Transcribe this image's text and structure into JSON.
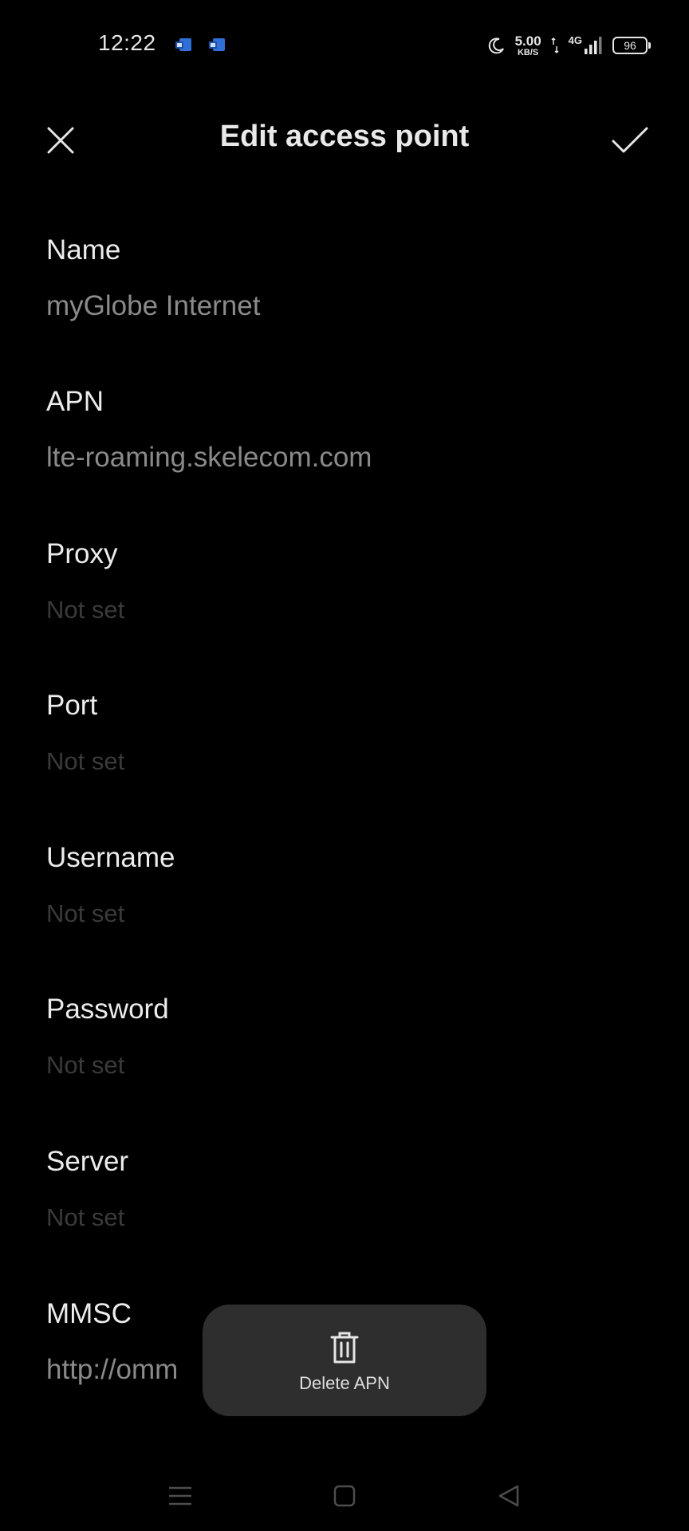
{
  "status_bar": {
    "time": "12:22",
    "speed_value": "5.00",
    "speed_unit": "KB/S",
    "network_type": "4G",
    "battery": "96",
    "icons": [
      "messenger-notification-icon",
      "messenger-notification-icon",
      "do-not-disturb-moon-icon",
      "data-transfer-arrows-icon",
      "cell-signal-icon",
      "battery-icon"
    ]
  },
  "header": {
    "title": "Edit access point",
    "close_icon": "close-icon",
    "confirm_icon": "check-icon"
  },
  "fields": [
    {
      "label": "Name",
      "value": "myGlobe Internet",
      "is_set": true
    },
    {
      "label": "APN",
      "value": "lte-roaming.skelecom.com",
      "is_set": true
    },
    {
      "label": "Proxy",
      "value": "Not set",
      "is_set": false
    },
    {
      "label": "Port",
      "value": "Not set",
      "is_set": false
    },
    {
      "label": "Username",
      "value": "Not set",
      "is_set": false
    },
    {
      "label": "Password",
      "value": "Not set",
      "is_set": false
    },
    {
      "label": "Server",
      "value": "Not set",
      "is_set": false
    },
    {
      "label": "MMSC",
      "value": "http://omm",
      "is_set": true
    }
  ],
  "delete_action": {
    "label": "Delete APN",
    "icon": "trash-icon"
  },
  "nav_bar": {
    "icons": [
      "menu-icon",
      "home-square-icon",
      "back-triangle-icon"
    ]
  },
  "colors": {
    "background": "#000000",
    "label": "#ececec",
    "value": "#8a8a8a",
    "placeholder": "#3a3a3a",
    "popup": "#2e2e2e"
  }
}
